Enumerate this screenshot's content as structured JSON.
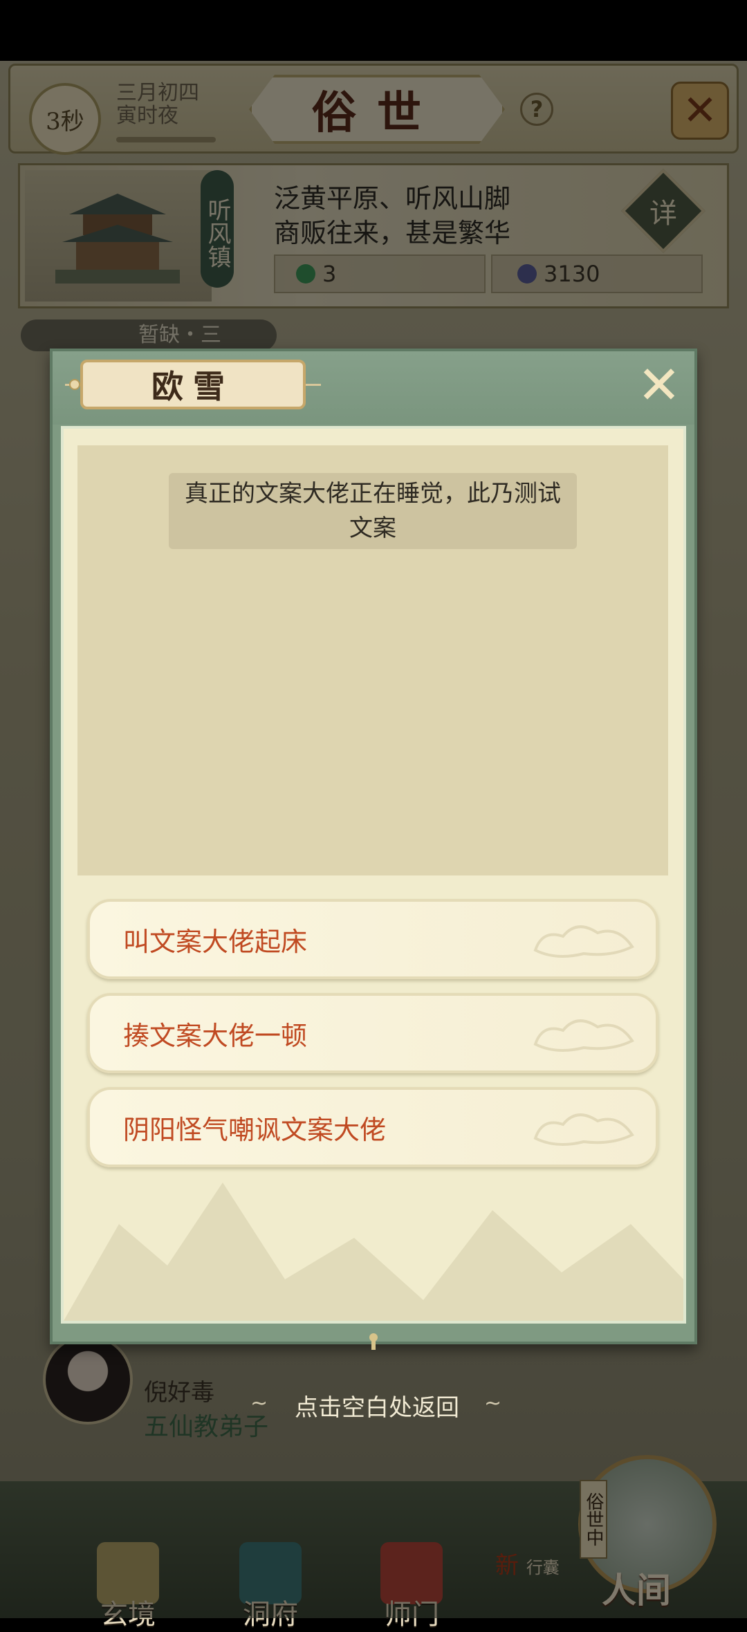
{
  "header": {
    "timer_label": "3秒",
    "date_line1": "三月初四",
    "date_line2": "寅时夜",
    "date_progress": 0.0,
    "title": "俗世",
    "help_label": "?"
  },
  "location": {
    "tag": "听风镇",
    "desc_line1": "泛黄平原、听风山脚",
    "desc_line2": "商贩往来，甚是繁华",
    "detail_label": "详",
    "resource_jade": "3",
    "resource_coin": "3130"
  },
  "scene_strip_text": "暂缺・三",
  "dialog": {
    "npc_name": "欧雪",
    "message": "真正的文案大佬正在睡觉，此乃测试文案",
    "options": [
      {
        "label": "叫文案大佬起床"
      },
      {
        "label": "揍文案大佬一顿"
      },
      {
        "label": "阴阳怪气嘲讽文案大佬"
      }
    ]
  },
  "return_hint": "点击空白处返回",
  "player": {
    "name": "倪好毒",
    "title": "五仙教弟子"
  },
  "nav": {
    "items": [
      {
        "label": "玄境"
      },
      {
        "label": "洞府"
      },
      {
        "label": "师门"
      }
    ],
    "xingnang_label": "行囊",
    "xingnang_badge": "新",
    "sushi_tag": "俗世中",
    "renjian_label": "人间"
  },
  "colors": {
    "accent_green": "#7f9a82",
    "option_text": "#c04a22",
    "parchment": "#f1eccd"
  }
}
